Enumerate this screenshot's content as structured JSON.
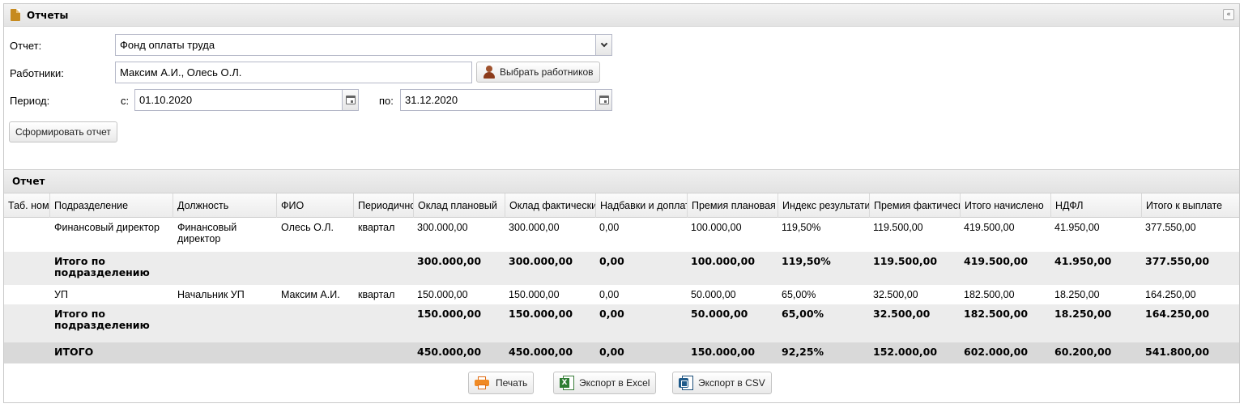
{
  "panel": {
    "title": "Отчеты",
    "collapse_glyph": "«"
  },
  "form": {
    "report_label": "Отчет:",
    "report_value": "Фонд оплаты труда",
    "workers_label": "Работники:",
    "workers_value": "Максим А.И., Олесь О.Л.",
    "select_workers_button": "Выбрать работников",
    "period_label": "Период:",
    "from_label": "с:",
    "from_value": "01.10.2020",
    "to_label": "по:",
    "to_value": "31.12.2020",
    "generate_button": "Сформировать отчет"
  },
  "report": {
    "title": "Отчет",
    "columns": [
      "Таб. номер",
      "Подразделение",
      "Должность",
      "ФИО",
      "Периодичность",
      "Оклад плановый",
      "Оклад фактический",
      "Надбавки и доплаты",
      "Премия плановая",
      "Индекс результативности",
      "Премия фактическая",
      "Итого начислено",
      "НДФЛ",
      "Итого к выплате"
    ],
    "rows": [
      {
        "tab": "",
        "dept": "Финансовый директор",
        "position": "Финансовый директор",
        "fio": "Олесь О.Л.",
        "period": "квартал",
        "salary_plan": "300.000,00",
        "salary_fact": "300.000,00",
        "bonus_add": "0,00",
        "premium_plan": "100.000,00",
        "index": "119,50%",
        "premium_fact": "119.500,00",
        "total_acc": "419.500,00",
        "ndfl": "41.950,00",
        "total_pay": "377.550,00"
      },
      {
        "tab": "",
        "dept": "Итого по подразделению",
        "position": "",
        "fio": "",
        "period": "",
        "salary_plan": "300.000,00",
        "salary_fact": "300.000,00",
        "bonus_add": "0,00",
        "premium_plan": "100.000,00",
        "index": "119,50%",
        "premium_fact": "119.500,00",
        "total_acc": "419.500,00",
        "ndfl": "41.950,00",
        "total_pay": "377.550,00"
      },
      {
        "tab": "",
        "dept": "УП",
        "position": "Начальник УП",
        "fio": "Максим А.И.",
        "period": "квартал",
        "salary_plan": "150.000,00",
        "salary_fact": "150.000,00",
        "bonus_add": "0,00",
        "premium_plan": "50.000,00",
        "index": "65,00%",
        "premium_fact": "32.500,00",
        "total_acc": "182.500,00",
        "ndfl": "18.250,00",
        "total_pay": "164.250,00"
      },
      {
        "tab": "",
        "dept": "Итого по подразделению",
        "position": "",
        "fio": "",
        "period": "",
        "salary_plan": "150.000,00",
        "salary_fact": "150.000,00",
        "bonus_add": "0,00",
        "premium_plan": "50.000,00",
        "index": "65,00%",
        "premium_fact": "32.500,00",
        "total_acc": "182.500,00",
        "ndfl": "18.250,00",
        "total_pay": "164.250,00"
      },
      {
        "tab": "",
        "dept": "ИТОГО",
        "position": "",
        "fio": "",
        "period": "",
        "salary_plan": "450.000,00",
        "salary_fact": "450.000,00",
        "bonus_add": "0,00",
        "premium_plan": "150.000,00",
        "index": "92,25%",
        "premium_fact": "152.000,00",
        "total_acc": "602.000,00",
        "ndfl": "60.200,00",
        "total_pay": "541.800,00"
      }
    ]
  },
  "footer": {
    "print_button": "Печать",
    "excel_button": "Экспорт в Excel",
    "csv_button": "Экспорт в CSV"
  }
}
